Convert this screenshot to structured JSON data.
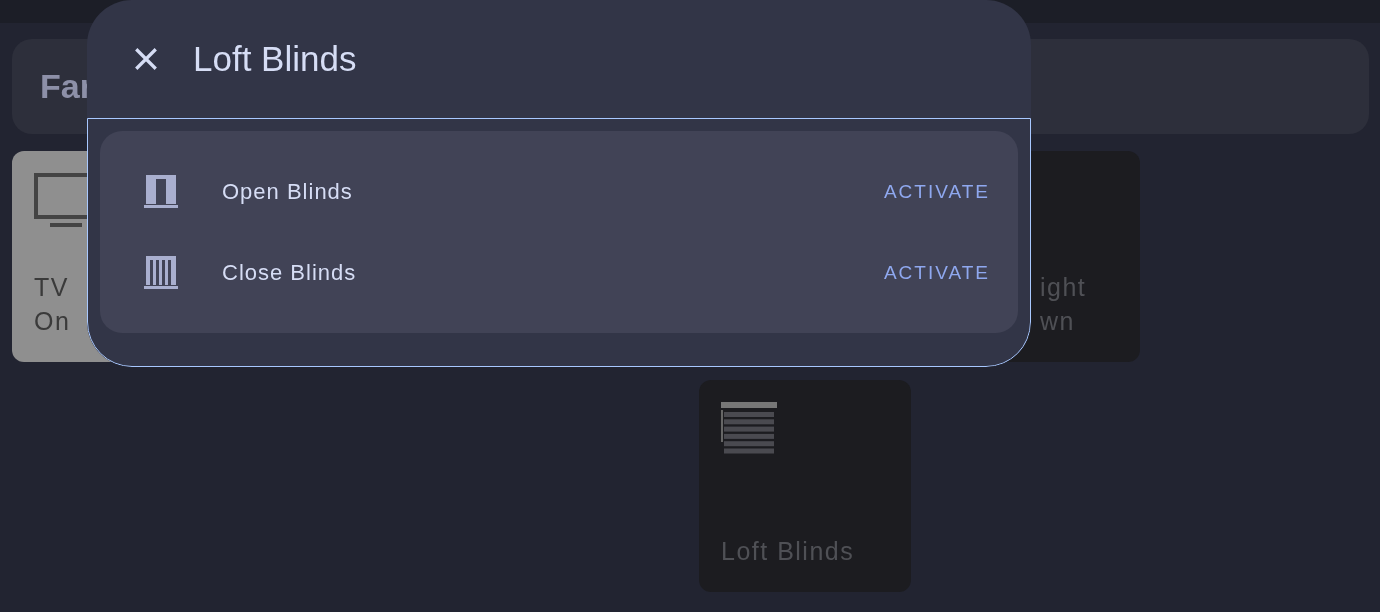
{
  "page": {
    "header": {
      "title": "Far"
    },
    "tiles": [
      {
        "kind": "tv",
        "on": true,
        "lines": [
          "TV",
          "On"
        ]
      },
      {
        "kind": "plain",
        "on": false,
        "lines": [
          "ight",
          "wn"
        ]
      },
      {
        "kind": "blinds",
        "on": false,
        "lines": [
          "Loft Blinds"
        ]
      }
    ]
  },
  "dialog": {
    "title": "Loft Blinds",
    "actions": [
      {
        "kind": "open",
        "label": "Open Blinds",
        "button": "ACTIVATE"
      },
      {
        "kind": "closed",
        "label": "Close Blinds",
        "button": "ACTIVATE"
      }
    ]
  }
}
